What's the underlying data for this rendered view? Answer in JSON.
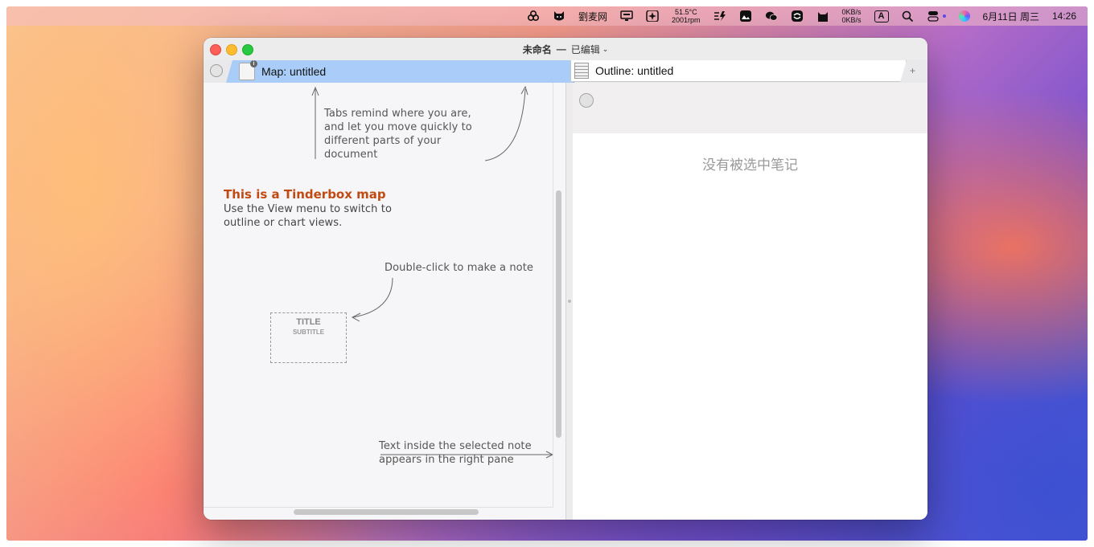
{
  "menubar": {
    "app_label": "劉麦网",
    "temperature": "51.5°C",
    "fan_speed": "2001rpm",
    "net_up": "0KB/s",
    "net_down": "0KB/s",
    "input_source": "A",
    "date": "6月11日 周三",
    "time": "14:26"
  },
  "window": {
    "title": "未命名",
    "separator": "—",
    "status": "已编辑",
    "dropdown_icon": "chevron-down"
  },
  "tabs": [
    {
      "label": "Map: untitled",
      "icon": "map-document-icon",
      "selected": true
    },
    {
      "label": "Outline: untitled",
      "icon": "outline-document-icon",
      "selected": false
    }
  ],
  "tab_add_label": "+",
  "map": {
    "heading": "This is a Tinderbox map",
    "description": "Use the View menu to switch to outline or chart views.",
    "tabs_note": "Tabs remind where you are, and let you move quickly to different parts of your document",
    "dblclick_note": "Double-click to make a note",
    "text_note": "Text inside the selected note appears in the right pane",
    "sample_note": {
      "title": "TITLE",
      "subtitle": "SUBTITLE"
    }
  },
  "outline": {
    "empty_message": "没有被选中笔记"
  },
  "colors": {
    "map_tab": "#a9cdf8",
    "map_heading": "#c14a12",
    "close": "#fe5f57",
    "minimize": "#febc2e",
    "maximize": "#28c840"
  }
}
